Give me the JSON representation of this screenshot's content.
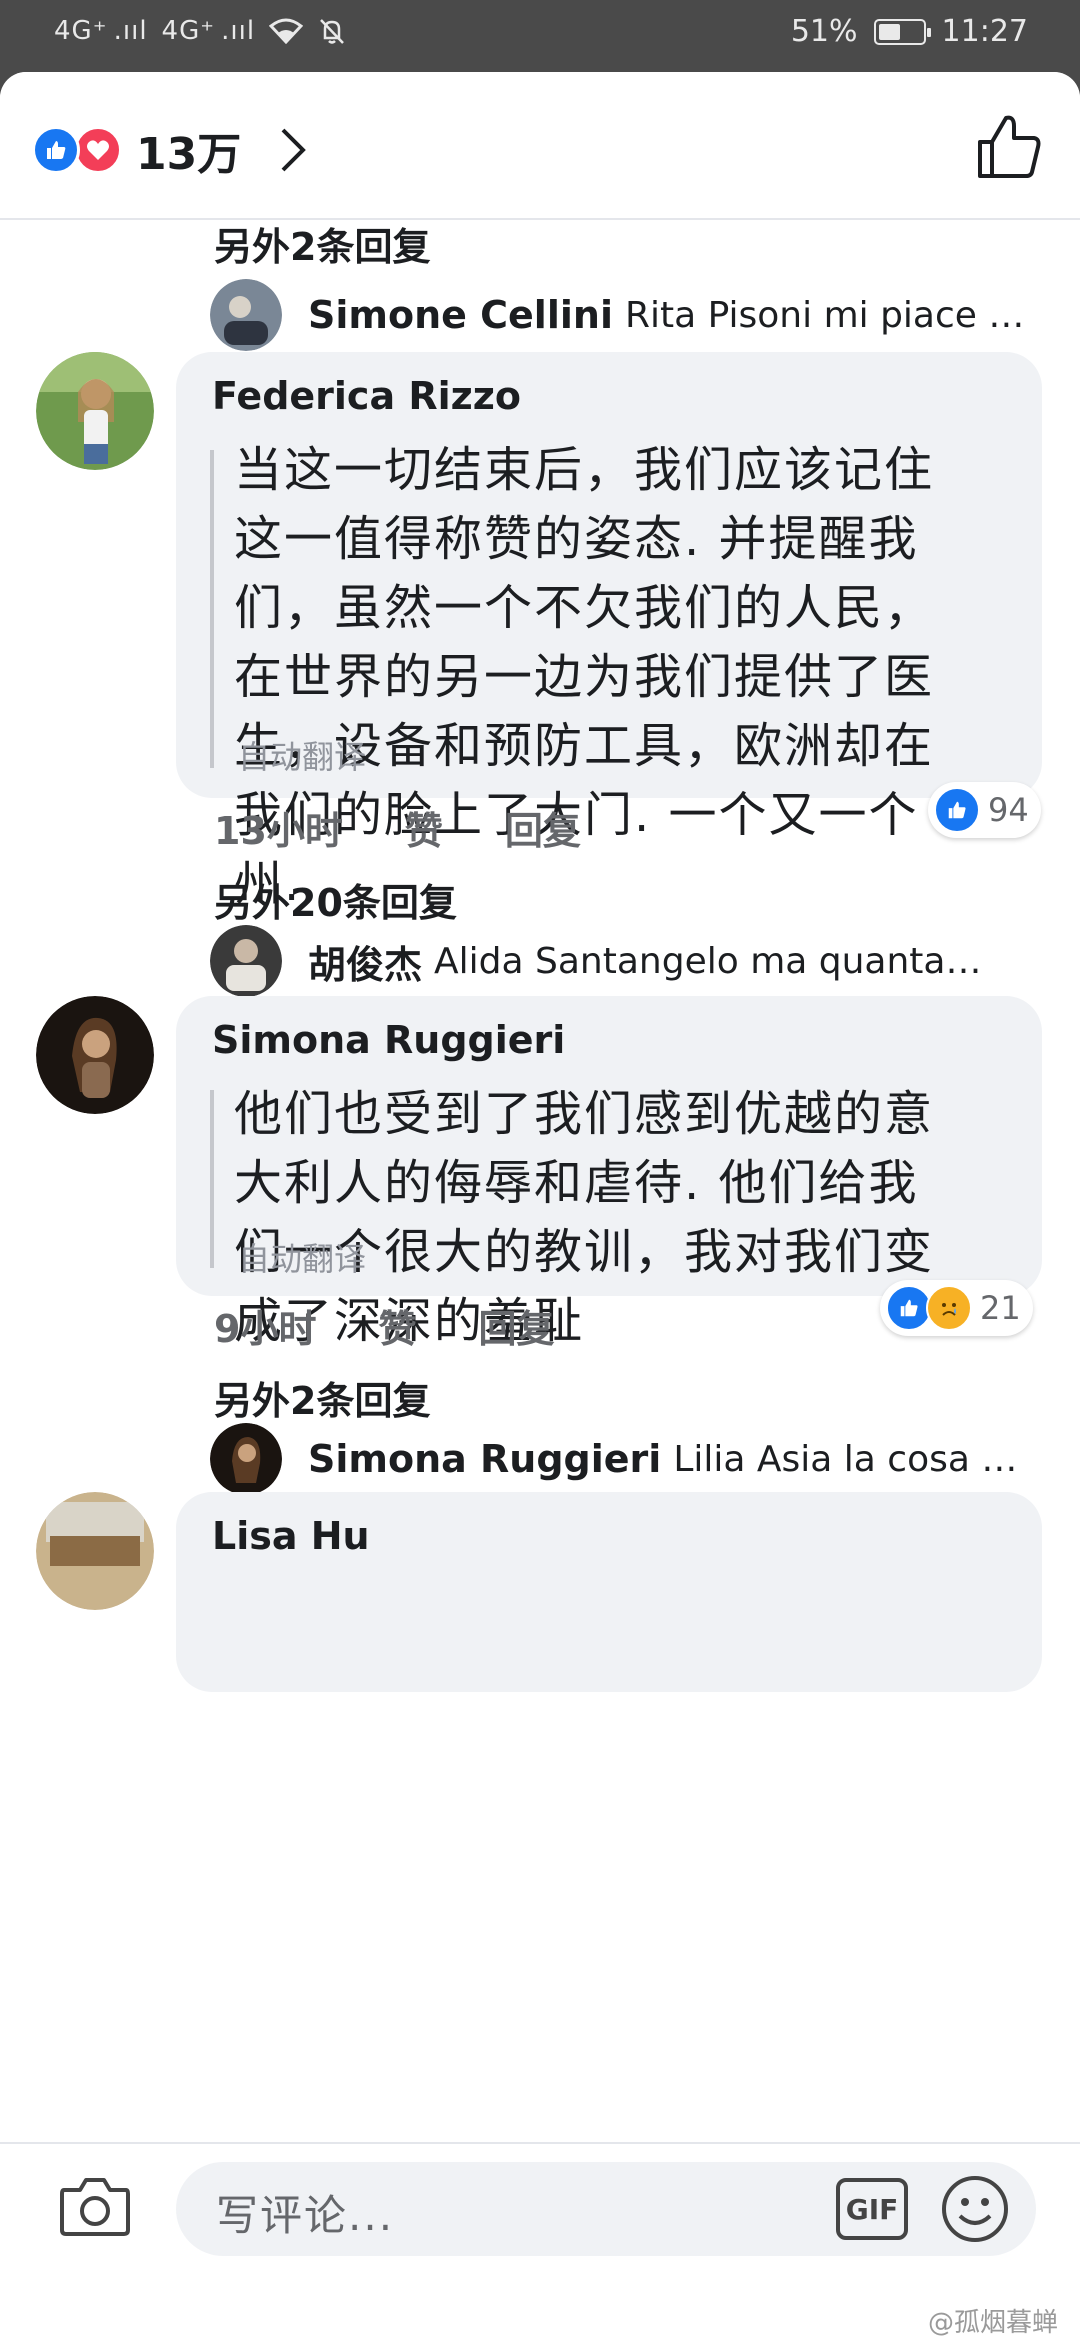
{
  "status_bar": {
    "signal1": "4G⁺ .ııl",
    "signal2": "4G⁺ .ııl",
    "battery_percent": "51%",
    "battery_level": 0.51,
    "time": "11:27"
  },
  "header": {
    "reaction_count": "13万"
  },
  "threads": [
    {
      "more_replies": "另外2条回复",
      "preview": {
        "name": "Simone Cellini",
        "text": "Rita Pisoni mi piace p…"
      }
    },
    {
      "author": "Federica Rizzo",
      "lines": [
        "当这一切结束后，我们应该记住",
        "这一值得称赞的姿态. 并提醒我",
        "们，虽然一个不欠我们的人民，",
        "在世界的另一边为我们提供了医",
        "生，设备和预防工具，欧洲却在",
        "我们的脸上了大门. 一个又一个",
        "州."
      ],
      "auto_translate": "自动翻译",
      "time": "13小时",
      "like": "赞",
      "reply": "回复",
      "reaction_count": "94",
      "more_replies": "另外20条回复",
      "preview": {
        "name": "胡俊杰",
        "text": "Alida Santangelo ma quanta…"
      }
    },
    {
      "author": "Simona Ruggieri",
      "lines": [
        "他们也受到了我们感到优越的意",
        "大利人的侮辱和虐待. 他们给我",
        "们一个很大的教训，我对我们变",
        "成了深深的羞耻"
      ],
      "auto_translate": "自动翻译",
      "time": "9小时",
      "like": "赞",
      "reply": "回复",
      "reaction_count": "21",
      "more_replies": "另外2条回复",
      "preview": {
        "name": "Simona Ruggieri",
        "text": "Lilia Asia la cosa gr…"
      }
    },
    {
      "author": "Lisa Hu"
    }
  ],
  "composer": {
    "placeholder": "写评论...",
    "gif_label": "GIF"
  },
  "watermark": "@孤烟暮蝉",
  "colors": {
    "facebook_blue": "#1877f2",
    "love_red": "#f33e58",
    "sad_yellow": "#f7b125",
    "bubble_gray": "#f0f2f5",
    "status_bar": "#4a4a4a"
  },
  "icons": [
    "like-icon",
    "love-icon",
    "chevron-right-icon",
    "thumbs-up-icon",
    "sad-icon",
    "camera-icon",
    "gif-icon",
    "smile-icon",
    "bell-off-icon",
    "wifi-icon"
  ]
}
